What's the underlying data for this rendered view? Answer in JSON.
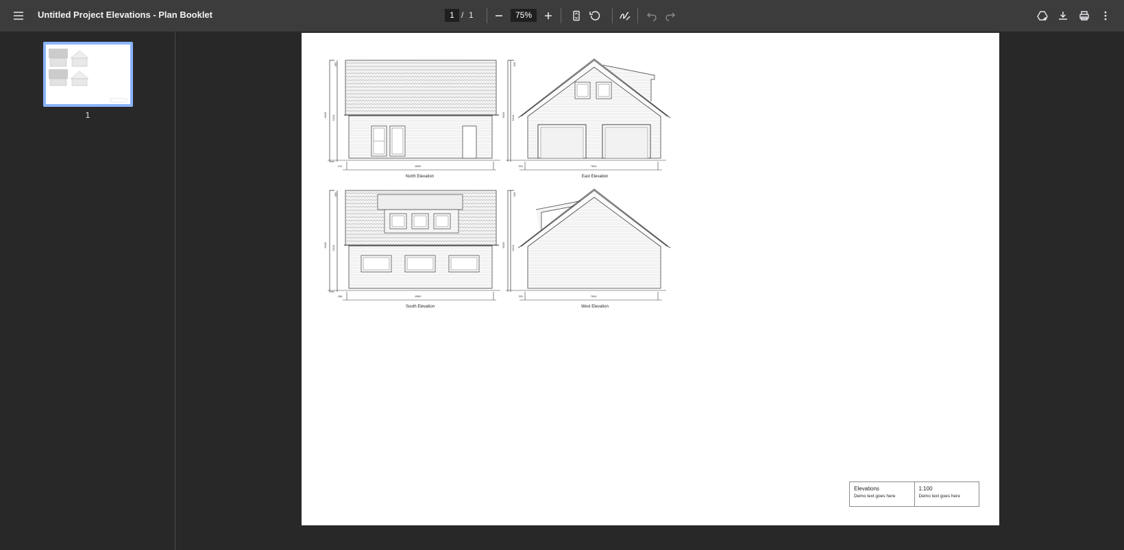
{
  "toolbar": {
    "title": "Untitled Project Elevations - Plan Booklet",
    "current_page": "1",
    "page_separator": "/",
    "total_pages": "1",
    "zoom": "75%"
  },
  "sidebar": {
    "thumbnails": [
      {
        "label": "1"
      }
    ]
  },
  "drawing": {
    "elevations": [
      {
        "name": "North Elevation",
        "width_dim": "8590",
        "left_dim": "212",
        "height_dim": "6049",
        "wall_dim": "5414",
        "top_dim": "360"
      },
      {
        "name": "East Elevation",
        "width_dim": "7604",
        "left_dim": "331",
        "height_dim": "6049",
        "wall_dim": "5414",
        "top_dim": "345"
      },
      {
        "name": "South Elevation",
        "width_dim": "8590",
        "left_dim": "186",
        "height_dim": "6049",
        "wall_dim": "5414",
        "top_dim": "360"
      },
      {
        "name": "West Elevation",
        "width_dim": "7604",
        "left_dim": "331",
        "height_dim": "6049",
        "wall_dim": "5414",
        "top_dim": "345"
      }
    ],
    "title_block": {
      "left_heading": "Elevations",
      "left_sub": "Demo text goes here",
      "right_heading": "1:100",
      "right_sub": "Demo text goes here"
    }
  }
}
